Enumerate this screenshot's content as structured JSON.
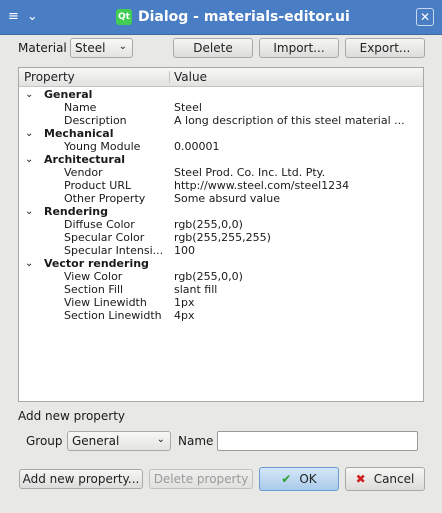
{
  "window": {
    "title": "Dialog - materials-editor.ui",
    "menu_icon": "≡",
    "collapse_icon": "⌄",
    "close_icon": "✕",
    "logo_text": "Qt"
  },
  "toolbar": {
    "material_label": "Material",
    "material_value": "Steel",
    "delete_label": "Delete",
    "import_label": "Import...",
    "export_label": "Export..."
  },
  "tree": {
    "header_property": "Property",
    "header_value": "Value",
    "groups": [
      {
        "name": "General",
        "props": [
          {
            "name": "Name",
            "value": "Steel"
          },
          {
            "name": "Description",
            "value": "A long description of this steel material ..."
          }
        ]
      },
      {
        "name": "Mechanical",
        "props": [
          {
            "name": "Young Module",
            "value": "0.00001"
          }
        ]
      },
      {
        "name": "Architectural",
        "props": [
          {
            "name": "Vendor",
            "value": "Steel Prod. Co. Inc. Ltd. Pty."
          },
          {
            "name": "Product URL",
            "value": "http://www.steel.com/steel1234"
          },
          {
            "name": "Other Property",
            "value": "Some absurd value"
          }
        ]
      },
      {
        "name": "Rendering",
        "props": [
          {
            "name": "Diffuse Color",
            "value": "rgb(255,0,0)"
          },
          {
            "name": "Specular Color",
            "value": "rgb(255,255,255)"
          },
          {
            "name": "Specular Intensi...",
            "value": "100"
          }
        ]
      },
      {
        "name": "Vector rendering",
        "props": [
          {
            "name": "View Color",
            "value": "rgb(255,0,0)"
          },
          {
            "name": "Section Fill",
            "value": "slant fill"
          },
          {
            "name": "View Linewidth",
            "value": "1px"
          },
          {
            "name": "Section Linewidth",
            "value": "4px"
          }
        ]
      }
    ]
  },
  "add_property": {
    "section_label": "Add new property",
    "group_label": "Group",
    "group_value": "General",
    "name_label": "Name",
    "name_value": ""
  },
  "footer": {
    "add_button": "Add new property...",
    "delete_button": "Delete property",
    "ok_button": "OK",
    "cancel_button": "Cancel"
  }
}
